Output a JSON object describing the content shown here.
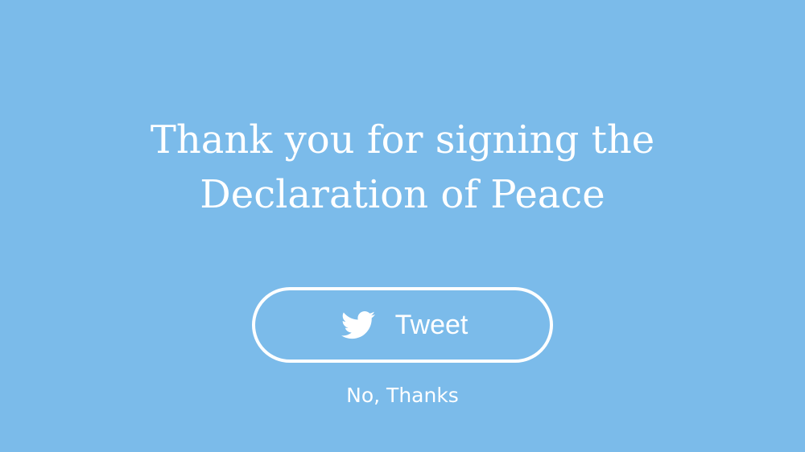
{
  "colors": {
    "background": "#7bbbea",
    "foreground": "#ffffff"
  },
  "headline": {
    "line1": "Thank you for signing the",
    "line2": "Declaration of Peace"
  },
  "tweet_button": {
    "label": "Tweet",
    "icon": "twitter-bird-icon"
  },
  "dismiss_link": {
    "label": "No, Thanks"
  }
}
